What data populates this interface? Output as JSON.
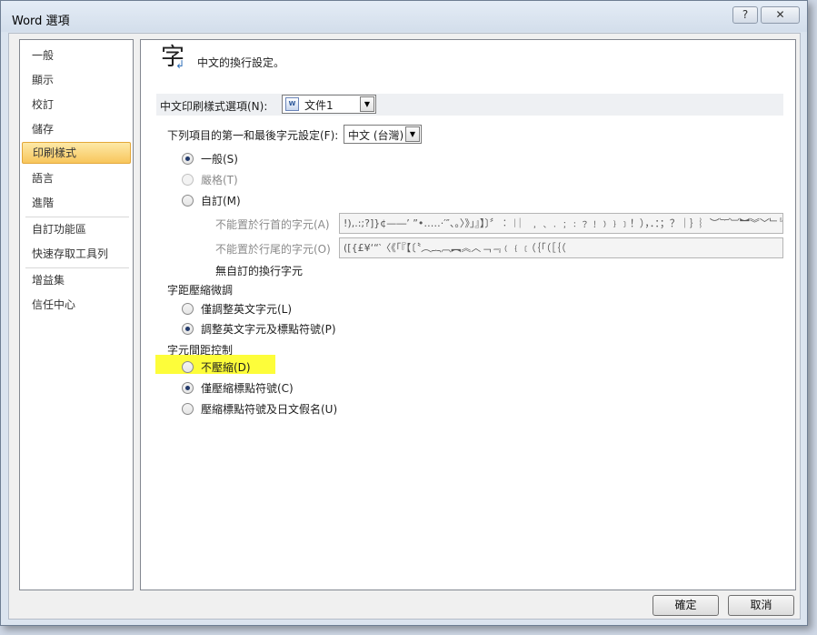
{
  "window": {
    "title": "Word 選項",
    "help_label": "?",
    "close_label": "✕"
  },
  "nav": {
    "items": [
      {
        "label": "一般"
      },
      {
        "label": "顯示"
      },
      {
        "label": "校訂"
      },
      {
        "label": "儲存"
      },
      {
        "label": "印刷樣式"
      },
      {
        "label": "語言"
      },
      {
        "label": "進階"
      },
      {
        "label": "自訂功能區"
      },
      {
        "label": "快速存取工具列"
      },
      {
        "label": "增益集"
      },
      {
        "label": "信任中心"
      }
    ],
    "selected": "印刷樣式"
  },
  "header": {
    "icon_glyph": "字",
    "icon_arrow": "↲",
    "text": "中文的換行設定。"
  },
  "typography_options": {
    "label": "中文印刷樣式選項(N):",
    "selected_document": "文件1",
    "doc_icon_text": "W"
  },
  "first_last_chars": {
    "label": "下列項目的第一和最後字元設定(F):",
    "selected_value": "中文 (台灣)",
    "options": [
      {
        "label": "一般(S)",
        "checked": true,
        "disabled": false
      },
      {
        "label": "嚴格(T)",
        "checked": false,
        "disabled": true
      },
      {
        "label": "自訂(M)",
        "checked": false,
        "disabled": false
      }
    ],
    "not_begin_label": "不能置於行首的字元(A)",
    "not_begin_value": "!),.:;?]}¢—―’ ”•…‥‧′″、。〉》」』】〕〞︰︱︳﹐﹑﹒﹔﹕﹖﹗﹚﹜﹞！），．：；？｜｝︴︶︸︺︼︾﹀﹂﹄﹏～￠、。」：；？！）〉》",
    "not_end_label": "不能置於行尾的字元(O)",
    "not_end_value": "([{£¥‘“‵〈《「『【〔〝︵︷︹︻︽︿﹁﹃﹙﹛﹝（｛｢（［｛（",
    "no_custom_label": "無自訂的換行字元"
  },
  "kerning": {
    "label": "字距壓縮微調",
    "options": [
      {
        "label": "僅調整英文字元(L)",
        "checked": false
      },
      {
        "label": "調整英文字元及標點符號(P)",
        "checked": true
      }
    ]
  },
  "spacing": {
    "label": "字元間距控制",
    "highlight_color": "#fdfd3a",
    "options": [
      {
        "label": "不壓縮(D)",
        "checked": false,
        "highlighted": true
      },
      {
        "label": "僅壓縮標點符號(C)",
        "checked": true,
        "highlighted": false
      },
      {
        "label": "壓縮標點符號及日文假名(U)",
        "checked": false,
        "highlighted": false
      }
    ]
  },
  "buttons": {
    "ok": "確定",
    "cancel": "取消"
  },
  "colors": {
    "selected_nav_top": "#fde9a7",
    "selected_nav_bottom": "#f8c65c",
    "highlight": "#fdfd3a"
  }
}
